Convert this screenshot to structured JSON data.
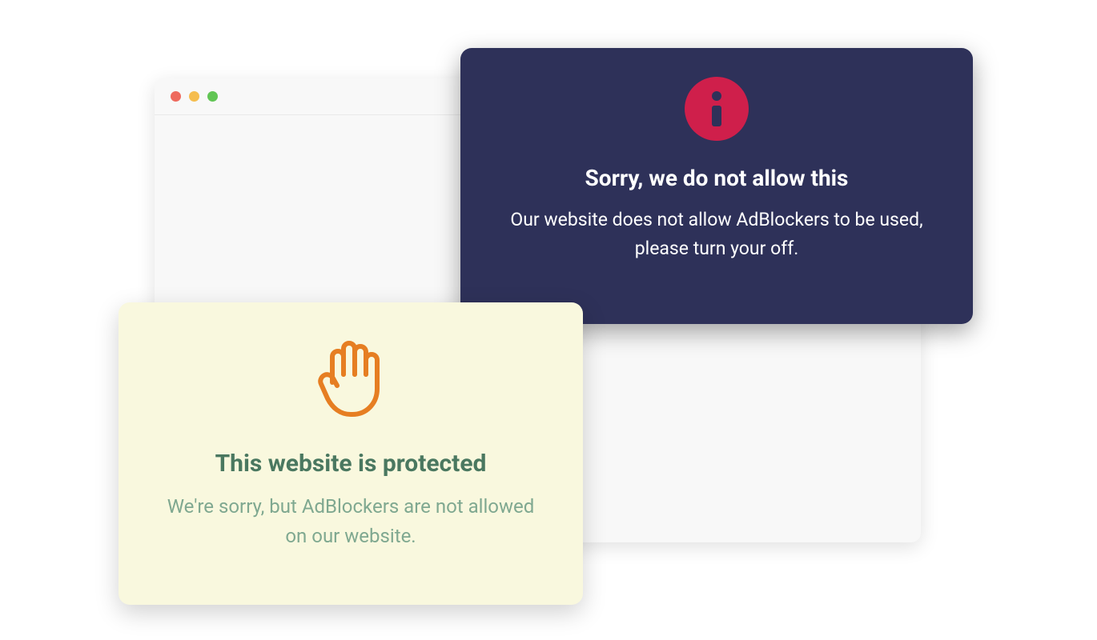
{
  "darkCard": {
    "title": "Sorry, we do not allow this",
    "text": "Our website does not allow AdBlockers to be used, please turn your off."
  },
  "lightCard": {
    "title": "This website is protected",
    "text": "We're sorry, but AdBlockers are not allowed on our website."
  }
}
